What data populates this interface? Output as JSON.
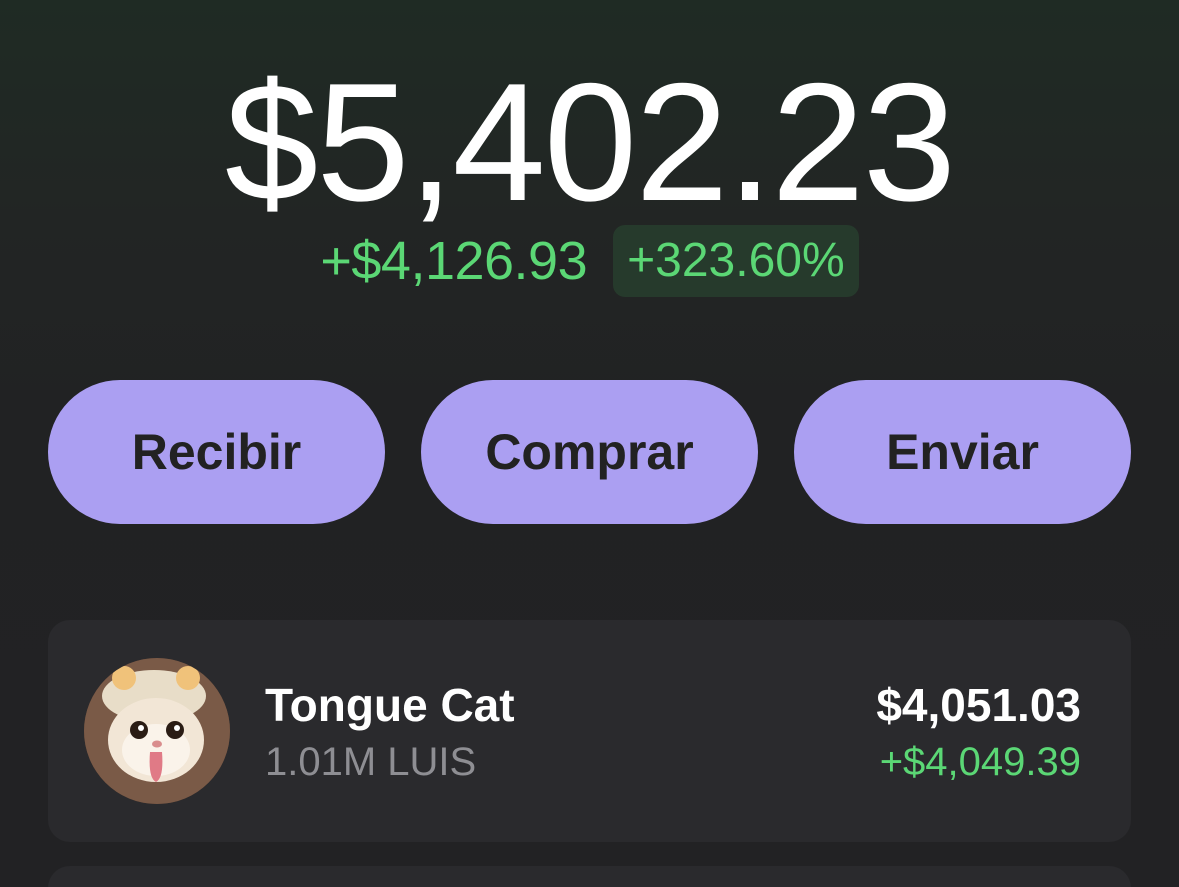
{
  "wallet": {
    "balance": "$5,402.23",
    "change_abs": "+$4,126.93",
    "change_pct": "+323.60%"
  },
  "actions": {
    "receive_label": "Recibir",
    "buy_label": "Comprar",
    "send_label": "Enviar"
  },
  "tokens": [
    {
      "name": "Tongue Cat",
      "amount": "1.01M LUIS",
      "value": "$4,051.03",
      "change": "+$4,049.39",
      "icon": "tongue-cat-avatar"
    }
  ],
  "colors": {
    "accent": "#ab9ff2",
    "positive": "#5bd775",
    "card": "#2a2a2d",
    "muted": "#8e8e93"
  }
}
